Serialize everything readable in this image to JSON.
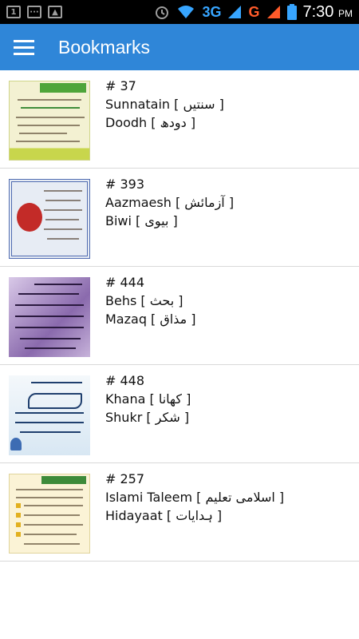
{
  "status_bar": {
    "network_3g": "3G",
    "network_g": "G",
    "time": "7:30",
    "ampm": "PM",
    "icons": [
      "sim-icon",
      "message-icon",
      "image-icon",
      "alarm-icon",
      "wifi-icon",
      "signal-icon",
      "battery-icon"
    ]
  },
  "app_bar": {
    "title": "Bookmarks",
    "menu_icon": "hamburger-menu-icon",
    "color": "#2f86d8"
  },
  "bookmarks": [
    {
      "number": "# 37",
      "word1": "Sunnatain",
      "urdu1": "سنتیں",
      "word2": "Doodh",
      "urdu2": "دودھ",
      "thumb_style": "green"
    },
    {
      "number": "# 393",
      "word1": "Aazmaesh",
      "urdu1": "آزمائش",
      "word2": "Biwi",
      "urdu2": "بیوی",
      "thumb_style": "frame"
    },
    {
      "number": "# 444",
      "word1": "Behs",
      "urdu1": "بحث",
      "word2": "Mazaq",
      "urdu2": "مذاق",
      "thumb_style": "purple"
    },
    {
      "number": "# 448",
      "word1": "Khana",
      "urdu1": "کھانا",
      "word2": "Shukr",
      "urdu2": "شکر",
      "thumb_style": "blue"
    },
    {
      "number": "# 257",
      "word1": "Islami Taleem",
      "urdu1": "اسلامی تعلیم",
      "word2": "Hidayaat",
      "urdu2": "ہدایات",
      "thumb_style": "cream"
    }
  ]
}
